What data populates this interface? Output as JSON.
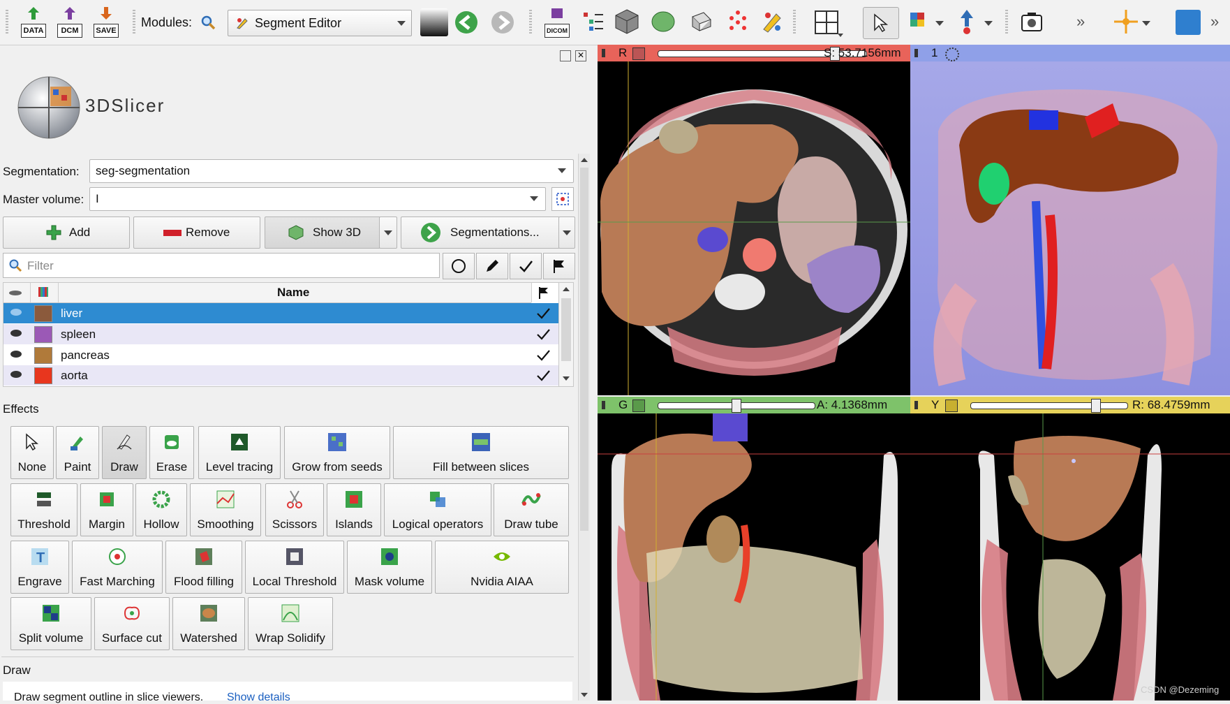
{
  "toolbar": {
    "data_label": "DATA",
    "dcm_label": "DCM",
    "save_label": "SAVE",
    "dicom_label": "DICOM",
    "modules_label": "Modules:",
    "module_selected": "Segment Editor",
    "overflow": "»"
  },
  "panel": {
    "logo_text": "3DSlicer",
    "segmentation_label": "Segmentation:",
    "segmentation_value": "seg-segmentation",
    "master_volume_label": "Master volume:",
    "master_volume_value": "I",
    "add_label": "Add",
    "remove_label": "Remove",
    "show3d_label": "Show 3D",
    "segmentations_label": "Segmentations...",
    "filter_placeholder": "Filter",
    "table_header_name": "Name",
    "segments": [
      {
        "name": "liver",
        "color": "#8b5a3c"
      },
      {
        "name": "spleen",
        "color": "#9b59b6"
      },
      {
        "name": "pancreas",
        "color": "#b07a3a"
      },
      {
        "name": "aorta",
        "color": "#e8361e"
      }
    ],
    "effects_label": "Effects",
    "effects": [
      "None",
      "Paint",
      "Draw",
      "Erase",
      "Level tracing",
      "Grow from seeds",
      "Fill between slices",
      "Threshold",
      "Margin",
      "Hollow",
      "Smoothing",
      "Scissors",
      "Islands",
      "Logical operators",
      "Draw tube",
      "Engrave",
      "Fast Marching",
      "Flood filling",
      "Local Threshold",
      "Mask volume",
      "Nvidia AIAA",
      "Split volume",
      "Surface cut",
      "Watershed",
      "Wrap Solidify"
    ],
    "draw_label": "Draw",
    "draw_desc": "Draw segment outline in slice viewers.",
    "show_details": "Show details"
  },
  "views": {
    "red": {
      "letter": "R",
      "readout": "S: 53.7156mm",
      "slider": 0.85
    },
    "threed": {
      "letter": "1"
    },
    "green": {
      "letter": "G",
      "readout": "A: 4.1368mm",
      "slider": 0.5
    },
    "yellow": {
      "letter": "Y",
      "readout": "R: 68.4759mm",
      "slider": 0.8
    }
  },
  "watermark": "CSDN @Dezeming",
  "colors": {
    "red_header": "#e8635a",
    "threed_header": "#8fa0e8",
    "green_header": "#7ec26a",
    "yellow_header": "#e6d25a",
    "selected_row": "#2e8bd1"
  }
}
